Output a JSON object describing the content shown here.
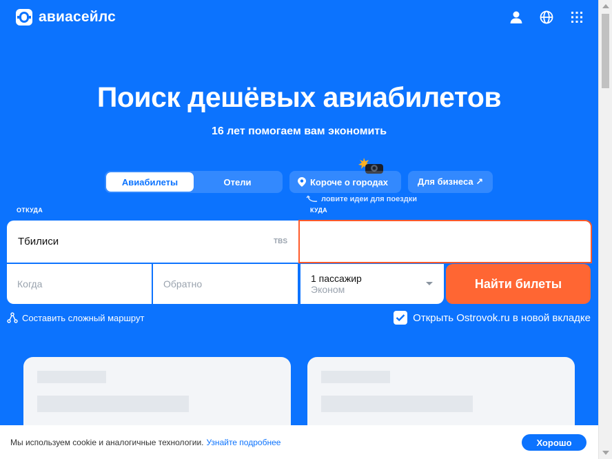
{
  "header": {
    "logo_text": "авиасейлс",
    "icons": [
      "user-icon",
      "globe-icon",
      "apps-grid-icon"
    ]
  },
  "hero": {
    "title": "Поиск дешёвых авиабилетов",
    "subtitle": "16 лет помогаем вам экономить"
  },
  "tabs": [
    {
      "label": "Авиабилеты",
      "active": true
    },
    {
      "label": "Отели",
      "active": false
    }
  ],
  "chips": {
    "cities": "Короче о городах",
    "business": "Для бизнеса ↗",
    "hint": "ловите идеи для поездки"
  },
  "form": {
    "from_label": "ОТКУДА",
    "to_label": "КУДА",
    "from_value": "Тбилиси",
    "from_code": "TBS",
    "to_value": "",
    "when_placeholder": "Когда",
    "back_placeholder": "Обратно",
    "passengers": "1 пассажир",
    "class": "Эконом",
    "search_button": "Найти билеты",
    "complex_route": "Составить сложный маршрут",
    "ostrovok_label": "Открыть Ostrovok.ru в новой вкладке",
    "ostrovok_checked": true
  },
  "cookie": {
    "text": "Мы используем cookie и аналогичные технологии.",
    "link": "Узнайте подробнее",
    "button": "Хорошо"
  },
  "colors": {
    "brand_blue": "#0C73FE",
    "accent_orange": "#FF6633",
    "error_border": "#FF5A2A"
  }
}
